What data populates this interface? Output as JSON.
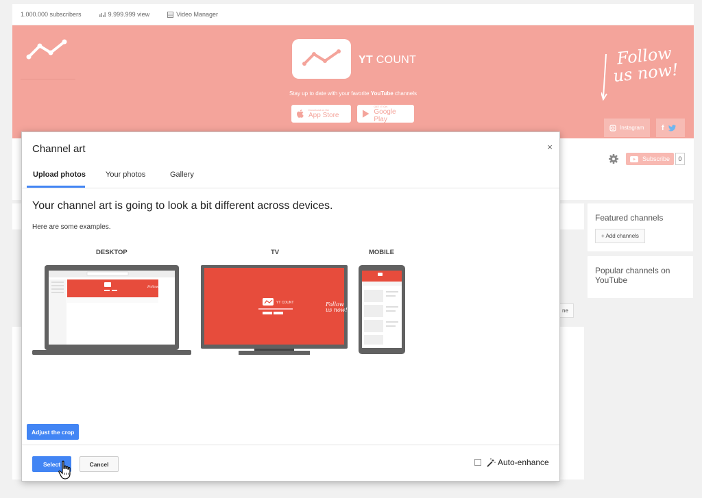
{
  "topbar": {
    "subscribers": "1.000.000 subscribers",
    "views": "9.999.999 view",
    "video_manager": "Video Manager"
  },
  "banner": {
    "brand_bold": "YT",
    "brand_rest": " COUNT",
    "tagline_pre": "Stay up to date with your favorite ",
    "tagline_bold": "YouTube",
    "tagline_post": " channels",
    "appstore_small": "Download on the",
    "appstore_big": "App Store",
    "googleplay_small": "GET IT ON",
    "googleplay_big": "Google Play",
    "follow_line1": "Follow",
    "follow_line2": "us now!",
    "instagram": "Instagram",
    "accent": "#f4a49b"
  },
  "channel": {
    "subscribe": "Subscribe",
    "count": "0",
    "partial_button": "ne"
  },
  "sidebar": {
    "featured_title": "Featured channels",
    "add_channels": "+ Add channels",
    "popular_title": "Popular channels on YouTube"
  },
  "modal": {
    "title": "Channel art",
    "close": "×",
    "tabs": [
      "Upload photos",
      "Your photos",
      "Gallery"
    ],
    "heading": "Your channel art is going to look a bit different across devices.",
    "subheading": "Here are some examples.",
    "devices": [
      "DESKTOP",
      "TV",
      "MOBILE"
    ],
    "adjust_crop": "Adjust the crop",
    "select": "Select",
    "cancel": "Cancel",
    "auto_enhance": "Auto-enhance",
    "primary_color": "#4285f4",
    "art_color": "#e74c3c"
  }
}
